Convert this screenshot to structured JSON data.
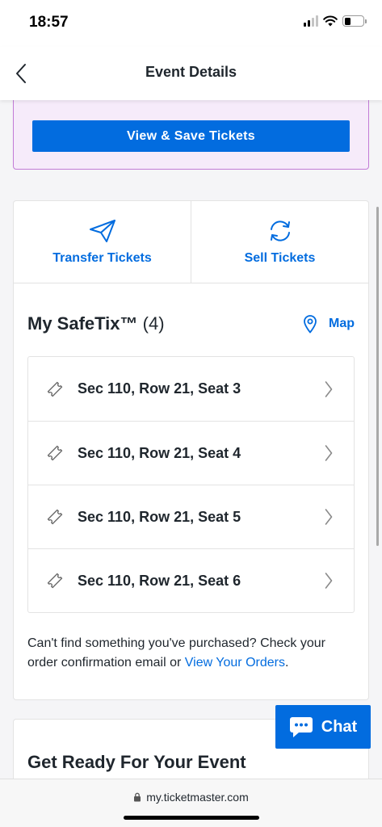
{
  "status_bar": {
    "time": "18:57"
  },
  "nav": {
    "title": "Event Details",
    "back_icon": "chevron-left-icon"
  },
  "promo": {
    "button_label": "View & Save Tickets"
  },
  "actions": [
    {
      "label": "Transfer Tickets",
      "icon": "paper-plane-icon"
    },
    {
      "label": "Sell Tickets",
      "icon": "refresh-cycle-icon"
    }
  ],
  "safetix": {
    "title": "My SafeTix™",
    "count": "(4)",
    "map_label": "Map",
    "seats": [
      {
        "label": "Sec 110, Row 21, Seat 3"
      },
      {
        "label": "Sec 110, Row 21, Seat 4"
      },
      {
        "label": "Sec 110, Row 21, Seat 5"
      },
      {
        "label": "Sec 110, Row 21, Seat 6"
      }
    ]
  },
  "help": {
    "text_before": "Can't find something you've purchased? Check your order confirmation email or ",
    "link": "View Your Orders",
    "text_after": "."
  },
  "next_section": {
    "title": "Get Ready For Your Event"
  },
  "chat": {
    "label": "Chat"
  },
  "browser": {
    "url": "my.ticketmaster.com"
  },
  "colors": {
    "brand_blue": "#026cdf",
    "promo_bg": "#f6ebfa",
    "promo_border": "#c27bd6"
  }
}
